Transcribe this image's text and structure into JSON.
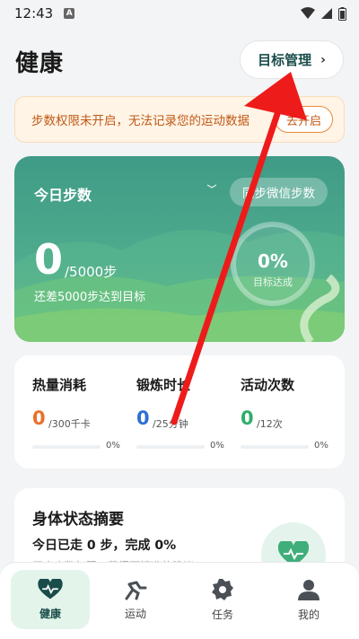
{
  "status_bar": {
    "time": "12:43",
    "badge": "A"
  },
  "header": {
    "title": "健康",
    "goal_button": "目标管理"
  },
  "warning": {
    "text": "步数权限未开启，无法记录您的运动数据",
    "action": "去开启"
  },
  "hero": {
    "label": "今日步数",
    "sync_button": "同步微信步数",
    "steps": "0",
    "goal": "/5000步",
    "remaining": "还差5000步达到目标",
    "percent": "0%",
    "percent_label": "目标达成",
    "progress": 0
  },
  "stats": [
    {
      "title": "热量消耗",
      "value": "0",
      "unit": "/300千卡",
      "percent": "0%",
      "color": "#e8702a",
      "progress": 0
    },
    {
      "title": "锻炼时长",
      "value": "0",
      "unit": "/25分钟",
      "percent": "0%",
      "color": "#2f6fd6",
      "progress": 0
    },
    {
      "title": "活动次数",
      "value": "0",
      "unit": "/12次",
      "percent": "0%",
      "color": "#2fae6a",
      "progress": 0
    }
  ],
  "summary": {
    "title": "身体状态摘要",
    "line": "今日已走 0 步，完成 0%",
    "hint": "开启步数权限，获得更精准的建议"
  },
  "tabs": [
    {
      "label": "健康",
      "icon": "heart-pulse-icon",
      "active": true
    },
    {
      "label": "运动",
      "icon": "runner-icon",
      "active": false
    },
    {
      "label": "任务",
      "icon": "badge-icon",
      "active": false
    },
    {
      "label": "我的",
      "icon": "person-icon",
      "active": false
    }
  ],
  "colors": {
    "brand": "#1a4d4a",
    "warning": "#c05a16",
    "arrow": "#ee1b1b"
  }
}
